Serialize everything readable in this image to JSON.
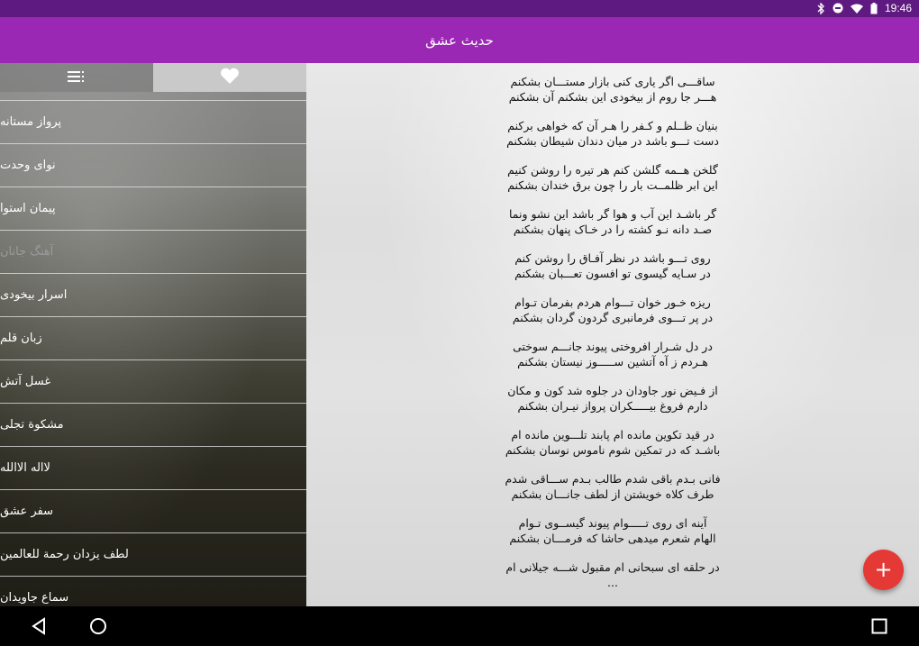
{
  "status_bar": {
    "time": "19:46"
  },
  "app_bar": {
    "title": "حدیث عشق"
  },
  "tabs": [
    {
      "name": "list",
      "icon": "list-icon"
    },
    {
      "name": "favorites",
      "icon": "heart-icon"
    }
  ],
  "menu": [
    {
      "label": "پرواز مستانه"
    },
    {
      "label": "نوای وحدت"
    },
    {
      "label": "پیمان استوا"
    },
    {
      "label": "آهنگ جانان"
    },
    {
      "label": "اسرار بیخودی"
    },
    {
      "label": "زبان قلم"
    },
    {
      "label": "غسل آتش"
    },
    {
      "label": "مشکوة تجلی"
    },
    {
      "label": "لااله الاالله"
    },
    {
      "label": "سفر عشق"
    },
    {
      "label": "لطف یزدان رحمة للعالمین"
    },
    {
      "label": "سماع جاویدان"
    }
  ],
  "poem": [
    [
      "ساقـــی اگر یاری کنی بازار مستـــان بشکنم",
      "هـــر جا روم از بیخودی این بشکنم آن بشکنم"
    ],
    [
      "بنیان ظــلم و کـفر را هـر آن که خواهی برکنم",
      "دست تـــو باشد در میان دندان شیطان بشکنم"
    ],
    [
      "گلخن هــمه گلشن کنم هر تیره را روشن کنیم",
      "این ابر ظلمــت بار را چون برق خندان بشکنم"
    ],
    [
      "گر باشـد این آب و هوا گر باشد این نشو ونما",
      "صـد دانه نـو کشته را در خـاک پنهان بشکنم"
    ],
    [
      "روی تـــو باشد در نظر آفـاق را روشن کنم",
      "در سـایه گیسوی تو افسون تعـــبان بشکنم"
    ],
    [
      "ریزه خـور خوان تـــوام هردم بفرمان تـوام",
      "در پر تـــوی فرمانبری گردون گردان بشکنم"
    ],
    [
      "در دل شـرار افروختی پیوند جانـــم سوختی",
      "هـردم ز آه آتشین ســـــوز نیستان بشکنم"
    ],
    [
      "از فـیض نور جاودان در جلوه شد کون و مکان",
      "دارم فروغ بیـــــکران پرواز نیـران بشکنم"
    ],
    [
      "در قید تکوین مانده ام پابند تلـــوین مانده ام",
      "باشـد که در تمکین شوم ناموس نوسان بشکنم"
    ],
    [
      "فانی بـدم باقی شدم طالب بـدم ســـاقی شدم",
      "طرف کلاه خویشتن از لطف جانـــان بشکنم"
    ],
    [
      "آینه ای روی تـــــوام پیوند گیســوی تـوام",
      "الهام شعرم میدهی حاشا که فرمـــان بشکنم"
    ],
    [
      "در حلقه ای سبحانی ام مقبول شـــه جیلانی ام",
      "..."
    ]
  ],
  "fab": {
    "label": "+"
  },
  "colors": {
    "status_bar": "#5e1a80",
    "app_bar": "#9b28b5",
    "fab": "#e53935"
  }
}
